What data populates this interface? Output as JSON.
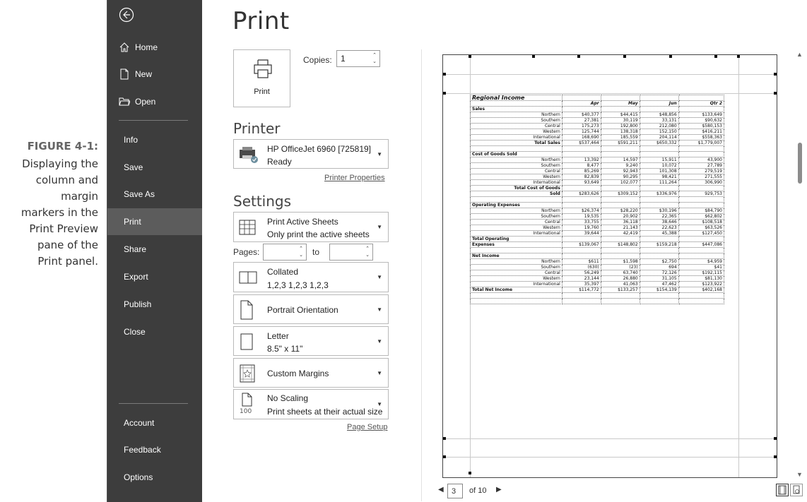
{
  "caption": {
    "figure": "FIGURE 4-1:",
    "line1": "Displaying the",
    "line2": "column and",
    "line3": "margin",
    "line4": "markers in the",
    "line5": "Print Preview",
    "line6": "pane of the",
    "line7": "Print panel."
  },
  "sidebar": {
    "home": "Home",
    "new": "New",
    "open": "Open",
    "info": "Info",
    "save": "Save",
    "save_as": "Save As",
    "print": "Print",
    "share": "Share",
    "export": "Export",
    "publish": "Publish",
    "close": "Close",
    "account": "Account",
    "feedback": "Feedback",
    "options": "Options",
    "selected": "Print"
  },
  "main": {
    "title": "Print",
    "print_button": "Print",
    "copies_label": "Copies:",
    "copies_value": "1",
    "printer_heading": "Printer",
    "printer_name": "HP OfficeJet 6960 [725819]",
    "printer_status": "Ready",
    "printer_properties": "Printer Properties",
    "settings_heading": "Settings",
    "sheets_title": "Print Active Sheets",
    "sheets_desc": "Only print the active sheets",
    "pages_label": "Pages:",
    "pages_from": "",
    "to_label": "to",
    "pages_to": "",
    "collated_title": "Collated",
    "collated_desc": "1,2,3   1,2,3   1,2,3",
    "orientation": "Portrait Orientation",
    "paper_title": "Letter",
    "paper_desc": "8.5\" x 11\"",
    "margins": "Custom Margins",
    "scaling_title": "No Scaling",
    "scaling_desc": "Print sheets at their actual size",
    "scaling_icon_text": "100",
    "page_setup": "Page Setup"
  },
  "pager": {
    "current": "3",
    "of_text": "of 10"
  },
  "sheet": {
    "title": "Regional Income",
    "columns": [
      "Apr",
      "May",
      "Jun",
      "Qtr 2"
    ],
    "rows": [
      {
        "label": "Sales",
        "type": "sec",
        "values": [
          "",
          "",
          "",
          ""
        ]
      },
      {
        "label": "Northern",
        "type": "row",
        "values": [
          "$40,377",
          "$44,415",
          "$48,856",
          "$133,649"
        ]
      },
      {
        "label": "Southern",
        "type": "row",
        "values": [
          "27,381",
          "30,119",
          "33,131",
          "$90,632"
        ]
      },
      {
        "label": "Central",
        "type": "row",
        "values": [
          "175,273",
          "192,800",
          "212,080",
          "$580,153"
        ]
      },
      {
        "label": "Western",
        "type": "row",
        "values": [
          "125,744",
          "138,318",
          "152,150",
          "$416,211"
        ]
      },
      {
        "label": "International",
        "type": "row",
        "values": [
          "168,690",
          "185,559",
          "204,114",
          "$558,363"
        ]
      },
      {
        "label": "Total Sales",
        "type": "bold",
        "values": [
          "$537,464",
          "$591,211",
          "$650,332",
          "$1,779,007"
        ]
      },
      {
        "label": "",
        "type": "blank",
        "values": [
          "",
          "",
          "",
          ""
        ]
      },
      {
        "label": "Cost of Goods Sold",
        "type": "sec",
        "values": [
          "",
          "",
          "",
          ""
        ]
      },
      {
        "label": "Northern",
        "type": "row",
        "values": [
          "13,392",
          "14,597",
          "15,911",
          "43,900"
        ]
      },
      {
        "label": "Southern",
        "type": "row",
        "values": [
          "8,477",
          "9,240",
          "10,072",
          "27,789"
        ]
      },
      {
        "label": "Central",
        "type": "row",
        "values": [
          "85,269",
          "92,943",
          "101,308",
          "279,519"
        ]
      },
      {
        "label": "Western",
        "type": "row",
        "values": [
          "82,839",
          "90,295",
          "98,421",
          "271,555"
        ]
      },
      {
        "label": "International",
        "type": "row",
        "values": [
          "93,649",
          "102,077",
          "111,264",
          "306,990"
        ]
      },
      {
        "label": "Total Cost of Goods",
        "type": "bold",
        "values": [
          "",
          "",
          "",
          ""
        ]
      },
      {
        "label": "Sold",
        "type": "bold",
        "values": [
          "$283,626",
          "$309,152",
          "$336,976",
          "929,753"
        ]
      },
      {
        "label": "",
        "type": "blank",
        "values": [
          "",
          "",
          "",
          ""
        ]
      },
      {
        "label": "Operating Expenses",
        "type": "sec",
        "values": [
          "",
          "",
          "",
          ""
        ]
      },
      {
        "label": "Northern",
        "type": "row",
        "values": [
          "$26,374",
          "$28,220",
          "$30,196",
          "$84,790"
        ]
      },
      {
        "label": "Southern",
        "type": "row",
        "values": [
          "19,535",
          "20,902",
          "22,365",
          "$62,802"
        ]
      },
      {
        "label": "Central",
        "type": "row",
        "values": [
          "33,755",
          "36,118",
          "38,646",
          "$108,518"
        ]
      },
      {
        "label": "Western",
        "type": "row",
        "values": [
          "19,760",
          "21,143",
          "22,623",
          "$63,526"
        ]
      },
      {
        "label": "International",
        "type": "row",
        "values": [
          "39,644",
          "42,419",
          "45,388",
          "$127,450"
        ]
      },
      {
        "label": "Total Operating",
        "type": "sec",
        "values": [
          "",
          "",
          "",
          ""
        ]
      },
      {
        "label": "Expenses",
        "type": "sec",
        "values": [
          "$139,067",
          "$148,802",
          "$159,218",
          "$447,086"
        ]
      },
      {
        "label": "",
        "type": "blank",
        "values": [
          "",
          "",
          "",
          ""
        ]
      },
      {
        "label": "Net Income",
        "type": "sec",
        "values": [
          "",
          "",
          "",
          ""
        ]
      },
      {
        "label": "Northern",
        "type": "row",
        "values": [
          "$611",
          "$1,598",
          "$2,750",
          "$4,959"
        ]
      },
      {
        "label": "Southern",
        "type": "row",
        "values": [
          "(630)",
          "(23)",
          "694",
          "$41"
        ]
      },
      {
        "label": "Central",
        "type": "row",
        "values": [
          "56,249",
          "63,740",
          "72,126",
          "$192,115"
        ]
      },
      {
        "label": "Western",
        "type": "row",
        "values": [
          "23,144",
          "26,880",
          "31,105",
          "$81,130"
        ]
      },
      {
        "label": "International",
        "type": "row",
        "values": [
          "35,397",
          "41,063",
          "47,462",
          "$123,922"
        ]
      },
      {
        "label": "Total Net Income",
        "type": "sec",
        "values": [
          "$114,772",
          "$133,257",
          "$154,139",
          "$402,168"
        ]
      },
      {
        "label": "",
        "type": "blank",
        "values": [
          "",
          "",
          "",
          ""
        ]
      },
      {
        "label": "",
        "type": "blank",
        "values": [
          "",
          "",
          "",
          ""
        ]
      }
    ]
  },
  "colors": {
    "sidebar_bg": "#3d3d3d",
    "sidebar_selected": "#5c5c5c"
  }
}
